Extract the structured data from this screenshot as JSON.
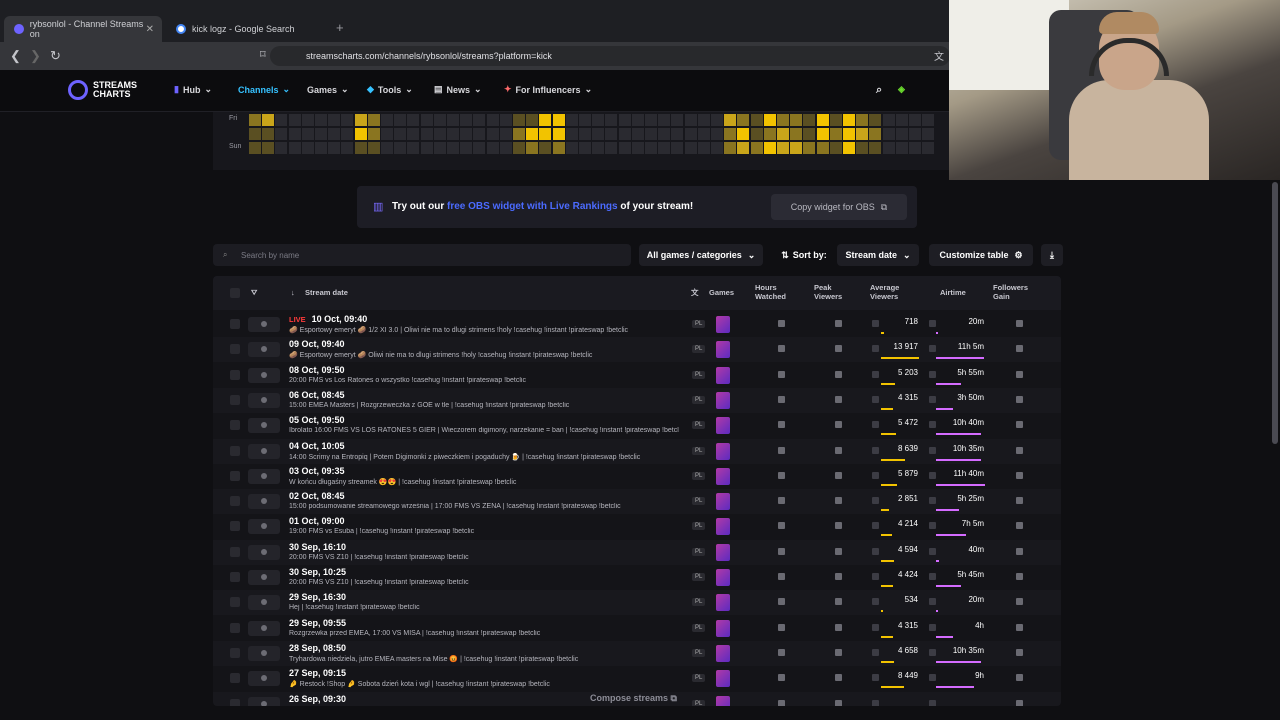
{
  "browser": {
    "tabs": [
      {
        "label": "rybsonlol - Channel Streams on"
      },
      {
        "label": "kick logz - Google Search"
      }
    ],
    "url": "streamscharts.com/channels/rybsonlol/streams?platform=kick"
  },
  "site": {
    "logo_line1": "STREAMS",
    "logo_line2": "CHARTS",
    "nav": [
      "Hub",
      "Channels",
      "Games",
      "Tools",
      "News",
      "For Influencers"
    ],
    "active_nav": "Channels"
  },
  "heatmap": {
    "row_labels": [
      "Fri",
      "Sun"
    ]
  },
  "banner": {
    "prefix": "Try out our",
    "highlight": "free OBS widget with Live Rankings",
    "suffix": "of your stream!",
    "copy_button": "Copy widget for OBS"
  },
  "toolbar": {
    "search_placeholder": "Search by name",
    "games_filter": "All games / categories",
    "sort_label": "Sort by:",
    "sort_value": "Stream date",
    "customize": "Customize table"
  },
  "table": {
    "headers": {
      "stream_date": "Stream date",
      "games": "Games",
      "hours_watched_1": "Hours",
      "hours_watched_2": "Watched",
      "peak_1": "Peak",
      "peak_2": "Viewers",
      "avg_1": "Average",
      "avg_2": "Viewers",
      "airtime": "Airtime",
      "followers_1": "Followers",
      "followers_2": "Gain"
    },
    "rows": [
      {
        "live": "LIVE",
        "date": "10 Oct, 09:40",
        "title": "🥔 Esportowy emeryt 🥔 1/2 XI 3.0 | Oliwi nie ma to dlugi strimens !holy !casehug !instant !pirateswap !betclic",
        "lang": "PL",
        "avg": "718",
        "airtime": "20m",
        "avg_pct": 0.08,
        "air_pct": 0.03
      },
      {
        "live": "",
        "date": "09 Oct, 09:40",
        "title": "🥔 Esportowy emeryt 🥔 Oliwi nie ma to dlugi strimens !holy !casehug !instant !pirateswap !betclic",
        "lang": "PL",
        "avg": "13 917",
        "airtime": "11h 5m",
        "avg_pct": 1.0,
        "air_pct": 0.95
      },
      {
        "live": "",
        "date": "08 Oct, 09:50",
        "title": "20:00 FMS vs Los Ratones o wszystko !casehug !instant !pirateswap !betclic",
        "lang": "PL",
        "avg": "5 203",
        "airtime": "5h 55m",
        "avg_pct": 0.37,
        "air_pct": 0.5
      },
      {
        "live": "",
        "date": "06 Oct, 08:45",
        "title": "15:00 EMEA Masters | Rozgrzeweczka z GOE w tle | !casehug !instant !pirateswap !betclic",
        "lang": "PL",
        "avg": "4 315",
        "airtime": "3h 50m",
        "avg_pct": 0.31,
        "air_pct": 0.33
      },
      {
        "live": "",
        "date": "05 Oct, 09:50",
        "title": "Ibrolato 16:00 FMS VS LOS RATONES 5 GIER | Wieczorem digimony, narzekanie = ban | !casehug !instant !pirateswap !betclic",
        "lang": "PL",
        "avg": "5 472",
        "airtime": "10h 40m",
        "avg_pct": 0.39,
        "air_pct": 0.9
      },
      {
        "live": "",
        "date": "04 Oct, 10:05",
        "title": "14:00 Scrimy na Entropiq | Potem Digimonki z piweczkiem i pogaduchy 🍺 | !casehug !instant !pirateswap !betclic",
        "lang": "PL",
        "avg": "8 639",
        "airtime": "10h 35m",
        "avg_pct": 0.62,
        "air_pct": 0.89
      },
      {
        "live": "",
        "date": "03 Oct, 09:35",
        "title": "W końcu długaśny streamek 😍😍 | !casehug !instant !pirateswap !betclic",
        "lang": "PL",
        "avg": "5 879",
        "airtime": "11h 40m",
        "avg_pct": 0.42,
        "air_pct": 0.98
      },
      {
        "live": "",
        "date": "02 Oct, 08:45",
        "title": "15:00 podsumowanie streamowego września | 17:00 FMS VS ZENA | !casehug !instant !pirateswap !betclic",
        "lang": "PL",
        "avg": "2 851",
        "airtime": "5h 25m",
        "avg_pct": 0.2,
        "air_pct": 0.46
      },
      {
        "live": "",
        "date": "01 Oct, 09:00",
        "title": "19:00 FMS vs Esuba | !casehug !instant !pirateswap !betclic",
        "lang": "PL",
        "avg": "4 214",
        "airtime": "7h 5m",
        "avg_pct": 0.3,
        "air_pct": 0.6
      },
      {
        "live": "",
        "date": "30 Sep, 16:10",
        "title": "20:00 FMS VS Z10 | !casehug !instant !pirateswap !betclic",
        "lang": "PL",
        "avg": "4 594",
        "airtime": "40m",
        "avg_pct": 0.33,
        "air_pct": 0.06
      },
      {
        "live": "",
        "date": "30 Sep, 10:25",
        "title": "20:00 FMS VS Z10 | !casehug !instant !pirateswap !betclic",
        "lang": "PL",
        "avg": "4 424",
        "airtime": "5h 45m",
        "avg_pct": 0.32,
        "air_pct": 0.49
      },
      {
        "live": "",
        "date": "29 Sep, 16:30",
        "title": "Hej | !casehug !instant !pirateswap !betclic",
        "lang": "PL",
        "avg": "534",
        "airtime": "20m",
        "avg_pct": 0.04,
        "air_pct": 0.03
      },
      {
        "live": "",
        "date": "29 Sep, 09:55",
        "title": "Rozgrzewka przed EMEA, 17:00 VS MISA | !casehug !instant !pirateswap !betclic",
        "lang": "PL",
        "avg": "4 315",
        "airtime": "4h",
        "avg_pct": 0.31,
        "air_pct": 0.34
      },
      {
        "live": "",
        "date": "28 Sep, 08:50",
        "title": "Tryhardowa niedziela, jutro EMEA masters na Mise 😡 | !casehug !instant !pirateswap !betclic",
        "lang": "PL",
        "avg": "4 658",
        "airtime": "10h 35m",
        "avg_pct": 0.33,
        "air_pct": 0.89
      },
      {
        "live": "",
        "date": "27 Sep, 09:15",
        "title": "🤌 Restock !Shop 🤌 Sobota dzień kota i wgl | !casehug !instant !pirateswap !betclic",
        "lang": "PL",
        "avg": "8 449",
        "airtime": "9h",
        "avg_pct": 0.6,
        "air_pct": 0.76
      },
      {
        "live": "",
        "date": "26 Sep, 09:30",
        "title": "",
        "lang": "PL",
        "avg": "",
        "airtime": "",
        "avg_pct": 0,
        "air_pct": 0
      }
    ],
    "compose_label": "Compose streams"
  },
  "colors": {
    "accent": "#36c2ff",
    "brand": "#6e63ff",
    "avg_bar": "#f2c300",
    "air_bar": "#d46bff",
    "live": "#ff3b3b"
  }
}
